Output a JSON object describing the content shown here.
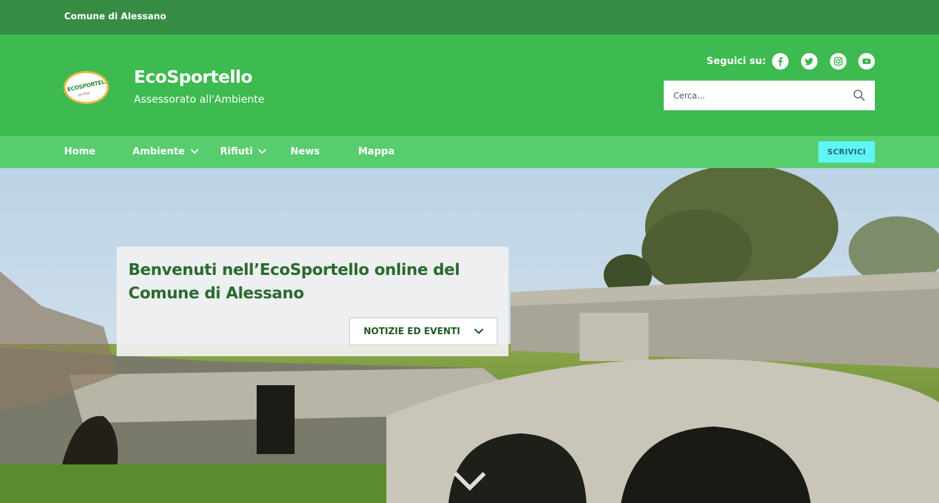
{
  "topbar": {
    "org_name": "Comune di Alessano"
  },
  "header": {
    "logo_text": "ECOSPORTELLO",
    "logo_sub": "on-line",
    "title": "EcoSportello",
    "subtitle": "Assessorato all'Ambiente",
    "follow_label": "Seguici su:",
    "social": [
      "facebook-icon",
      "twitter-icon",
      "instagram-icon",
      "youtube-icon"
    ],
    "search_placeholder": "Cerca..."
  },
  "nav": {
    "items": [
      {
        "label": "Home"
      },
      {
        "label": "Ambiente",
        "dropdown": true
      },
      {
        "label": "Rifiuti",
        "dropdown": true
      },
      {
        "label": "News"
      },
      {
        "label": "Mappa"
      }
    ],
    "cta_label": "SCRIVICI"
  },
  "hero": {
    "heading": "Benvenuti nell’EcoSportello online del Comune di Alessano",
    "button_label": "NOTIZIE ED EVENTI"
  },
  "colors": {
    "topbar": "#378c44",
    "header": "#3dba50",
    "nav": "#58cd6e",
    "cta": "#5ff5f7",
    "heading": "#2a6a2e"
  }
}
